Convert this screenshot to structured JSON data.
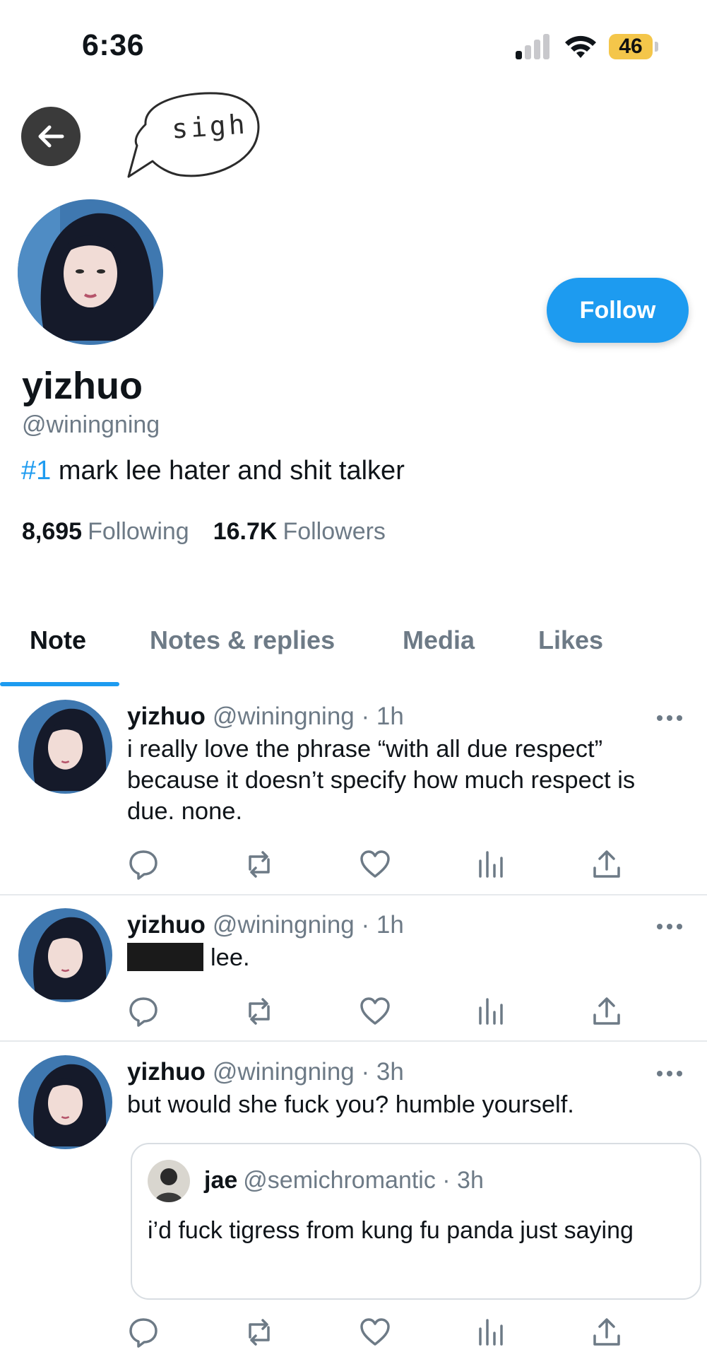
{
  "status_bar": {
    "time": "6:36",
    "battery": "46",
    "battery_color": "#f4c64a"
  },
  "annotation": {
    "text": "sigh"
  },
  "profile": {
    "display_name": "yizhuo",
    "handle": "@winingning",
    "bio_hashtag": "#1",
    "bio_rest": " mark lee hater and shit talker",
    "following_count": "8,695",
    "following_label": "Following",
    "followers_count": "16.7K",
    "followers_label": "Followers",
    "follow_label": "Follow"
  },
  "tabs": [
    {
      "label": "Note",
      "active": true
    },
    {
      "label": "Notes & replies",
      "active": false
    },
    {
      "label": "Media",
      "active": false
    },
    {
      "label": "Likes",
      "active": false
    }
  ],
  "posts": [
    {
      "name": "yizhuo",
      "meta": "@winingning · 1h",
      "text": "i really love the phrase “with all due respect” because it doesn’t specify how much respect is due. none."
    },
    {
      "name": "yizhuo",
      "meta": "@winingning · 1h",
      "text": "lee."
    },
    {
      "name": "yizhuo",
      "meta": "@winingning · 3h",
      "text": "but would she fuck you? humble yourself.",
      "quote": {
        "name": "jae",
        "meta": "@semichromantic · 3h",
        "text": "i’d fuck tigress from kung fu panda just saying"
      }
    }
  ],
  "colors": {
    "accent": "#1d9bf0",
    "muted": "#6d7a86",
    "text": "#0f1419"
  }
}
